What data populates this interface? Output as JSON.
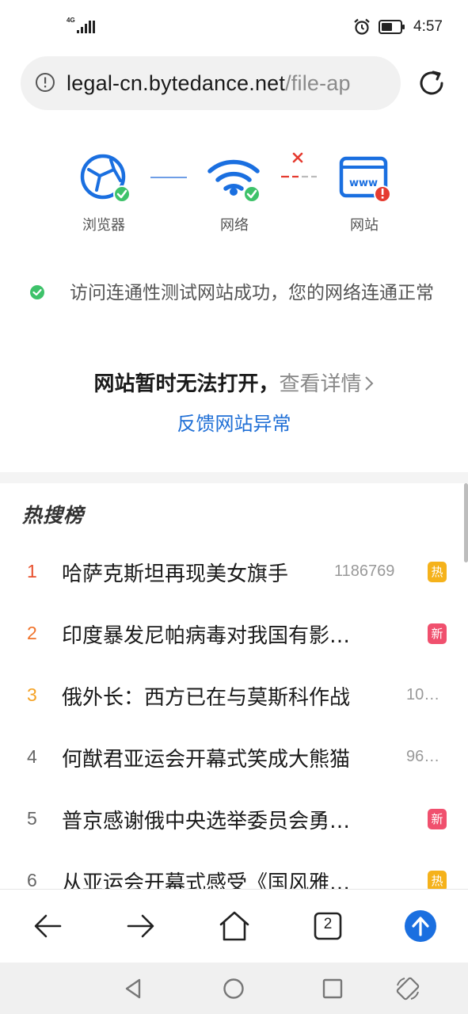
{
  "status_bar": {
    "network_type": "4G",
    "time": "4:57"
  },
  "address_bar": {
    "url_host": "legal-cn.bytedance.net",
    "url_path": "/file-ap"
  },
  "diagnostics": {
    "items": [
      {
        "label": "浏览器",
        "status": "ok"
      },
      {
        "label": "网络",
        "status": "ok"
      },
      {
        "label": "网站",
        "status": "error"
      }
    ],
    "success_message": "访问连通性测试网站成功，您的网络连通正常",
    "unable_text": "网站暂时无法打开，",
    "details_link": "查看详情",
    "feedback_link": "反馈网站异常"
  },
  "hot_search": {
    "title": "热搜榜",
    "items": [
      {
        "rank": "1",
        "text": "哈萨克斯坦再现美女旗手",
        "count": "1186769",
        "badge": "热"
      },
      {
        "rank": "2",
        "text": "印度暴发尼帕病毒对我国有影…",
        "count": "",
        "badge": "新"
      },
      {
        "rank": "3",
        "text": "俄外长：西方已在与莫斯科作战",
        "count": "10…",
        "badge": ""
      },
      {
        "rank": "4",
        "text": "何猷君亚运会开幕式笑成大熊猫",
        "count": "96…",
        "badge": ""
      },
      {
        "rank": "5",
        "text": "普京感谢俄中央选举委员会勇…",
        "count": "",
        "badge": "新"
      },
      {
        "rank": "6",
        "text": "从亚运会开幕式感受《国风雅…",
        "count": "",
        "badge": "热"
      }
    ]
  },
  "toolbar": {
    "tab_count": "2"
  },
  "colors": {
    "link_blue": "#1f6fd6",
    "icon_blue": "#1a6fe0",
    "success_green": "#3ec26a",
    "error_red": "#e53b30",
    "rank1": "#e8512e",
    "rank2": "#f0732b",
    "rank3": "#f5a224",
    "rank_other": "#666666",
    "badge_hot": "#f5b21b",
    "badge_new": "#f0506e"
  }
}
